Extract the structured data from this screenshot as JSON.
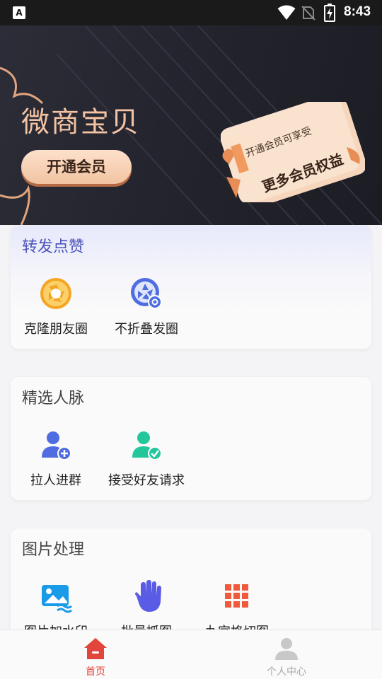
{
  "status_bar": {
    "left_icon": "A",
    "time": "8:43",
    "icons": [
      "app-notification-icon",
      "wifi-icon",
      "no-sim-icon",
      "battery-charging-icon"
    ]
  },
  "banner": {
    "brand_name": "微商宝贝",
    "join_button": "开通会员",
    "card_line1": "开通会员可享受",
    "card_line2": "更多会员权益",
    "accent_color": "#f3c4a4"
  },
  "sections": {
    "share_like": {
      "title": "转发点赞",
      "items": [
        {
          "label": "克隆朋友圈",
          "icon": "aperture-icon"
        },
        {
          "label": "不折叠发圈",
          "icon": "aperture-settings-icon"
        }
      ]
    },
    "contacts": {
      "title": "精选人脉",
      "items": [
        {
          "label": "拉人进群",
          "icon": "add-user-icon"
        },
        {
          "label": "接受好友请求",
          "icon": "accept-user-icon"
        }
      ]
    },
    "image_processing": {
      "title": "图片处理",
      "items": [
        {
          "label": "图片加水印",
          "icon": "image-watermark-icon"
        },
        {
          "label": "批量抓图",
          "icon": "hand-grab-icon"
        },
        {
          "label": "九宫格切图",
          "icon": "grid-nine-icon"
        }
      ]
    }
  },
  "bottom_nav": {
    "home": "首页",
    "profile": "个人中心",
    "active_color": "#e2453b",
    "inactive_color": "#a6a6a6"
  }
}
